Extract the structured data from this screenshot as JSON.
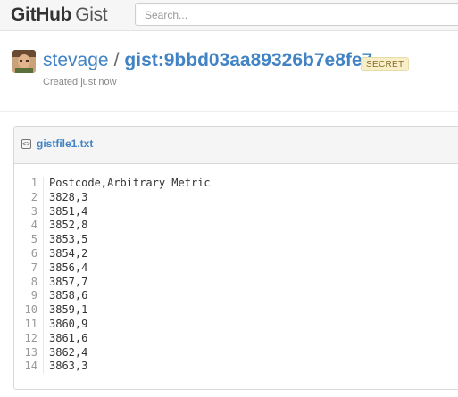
{
  "header": {
    "logo_main": "GitHub",
    "logo_sub": "Gist",
    "search_placeholder": "Search..."
  },
  "gist": {
    "owner": "stevage",
    "separator": "/",
    "id_label": "gist:9bbd03aa89326b7e8fe7",
    "badge": "SECRET",
    "created": "Created just now"
  },
  "file": {
    "icon": "code-file-icon",
    "name": "gistfile1.txt",
    "lines": [
      "Postcode,Arbitrary Metric",
      "3828,3",
      "3851,4",
      "3852,8",
      "3853,5",
      "3854,2",
      "3856,4",
      "3857,7",
      "3858,6",
      "3859,1",
      "3860,9",
      "3861,6",
      "3862,4",
      "3863,3"
    ]
  }
}
